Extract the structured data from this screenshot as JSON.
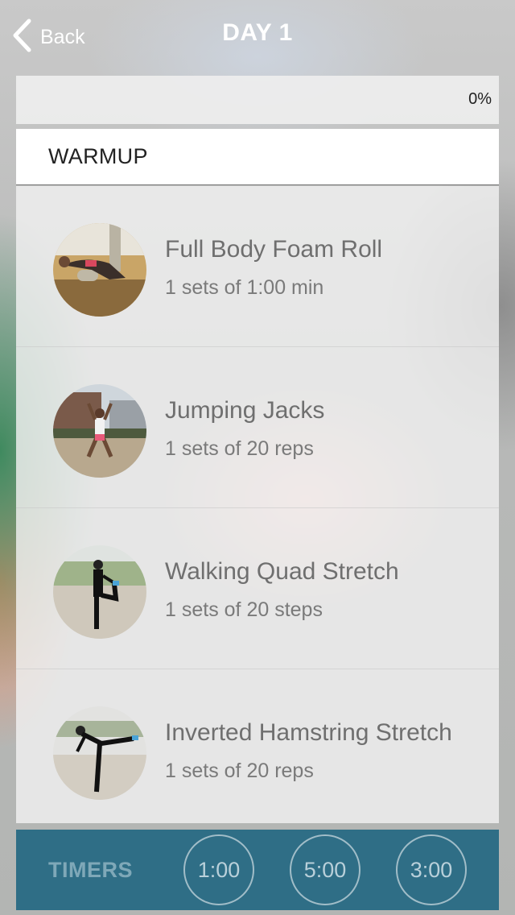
{
  "nav": {
    "back_label": "Back",
    "title": "DAY 1"
  },
  "progress": {
    "label": "0%",
    "fraction": 0
  },
  "section": {
    "title": "WARMUP"
  },
  "exercises": [
    {
      "name": "Full Body Foam Roll",
      "detail": "1 sets of 1:00 min"
    },
    {
      "name": "Jumping Jacks",
      "detail": "1 sets of 20 reps"
    },
    {
      "name": "Walking Quad Stretch",
      "detail": "1 sets of 20 steps"
    },
    {
      "name": "Inverted Hamstring Stretch",
      "detail": "1 sets of 20 reps"
    }
  ],
  "timers": {
    "label": "TIMERS",
    "buttons": [
      "1:00",
      "5:00",
      "3:00"
    ]
  },
  "colors": {
    "accent": "#2f6e86",
    "white": "#ffffff"
  }
}
